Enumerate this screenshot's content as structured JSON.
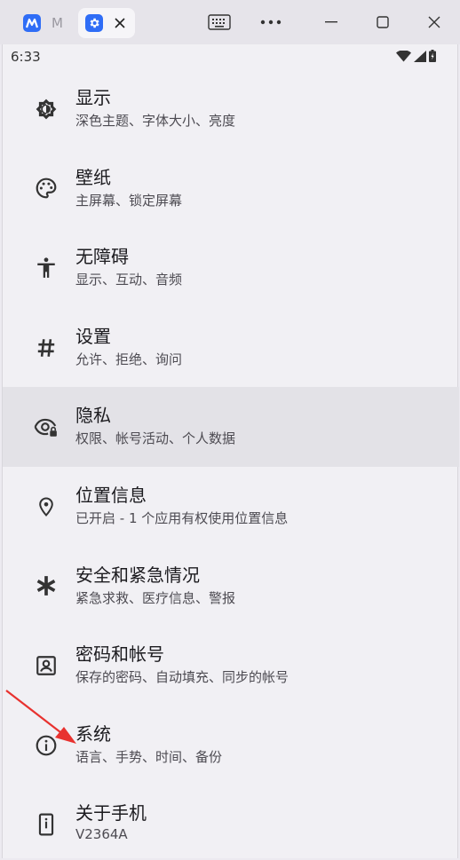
{
  "window": {
    "tabs": [
      {
        "title": "M",
        "active": false
      },
      {
        "title": "",
        "active": true
      }
    ]
  },
  "statusbar": {
    "time": "6:33"
  },
  "settings": [
    {
      "icon": "display-brightness-icon",
      "title": "显示",
      "subtitle": "深色主题、字体大小、亮度"
    },
    {
      "icon": "palette-icon",
      "title": "壁纸",
      "subtitle": "主屏幕、锁定屏幕"
    },
    {
      "icon": "accessibility-icon",
      "title": "无障碍",
      "subtitle": "显示、互动、音频"
    },
    {
      "icon": "hash-icon",
      "title": "设置",
      "subtitle": "允许、拒绝、询问"
    },
    {
      "icon": "privacy-eye-lock-icon",
      "title": "隐私",
      "subtitle": "权限、帐号活动、个人数据"
    },
    {
      "icon": "location-pin-icon",
      "title": "位置信息",
      "subtitle": "已开启 - 1 个应用有权使用位置信息"
    },
    {
      "icon": "emergency-asterisk-icon",
      "title": "安全和紧急情况",
      "subtitle": "紧急求救、医疗信息、警报"
    },
    {
      "icon": "account-box-icon",
      "title": "密码和帐号",
      "subtitle": "保存的密码、自动填充、同步的帐号"
    },
    {
      "icon": "info-icon",
      "title": "系统",
      "subtitle": "语言、手势、时间、备份"
    },
    {
      "icon": "phone-icon",
      "title": "关于手机",
      "subtitle": "V2364A"
    }
  ],
  "colors": {
    "accent": "#2f6df6",
    "annotation_arrow": "#e8322f"
  }
}
